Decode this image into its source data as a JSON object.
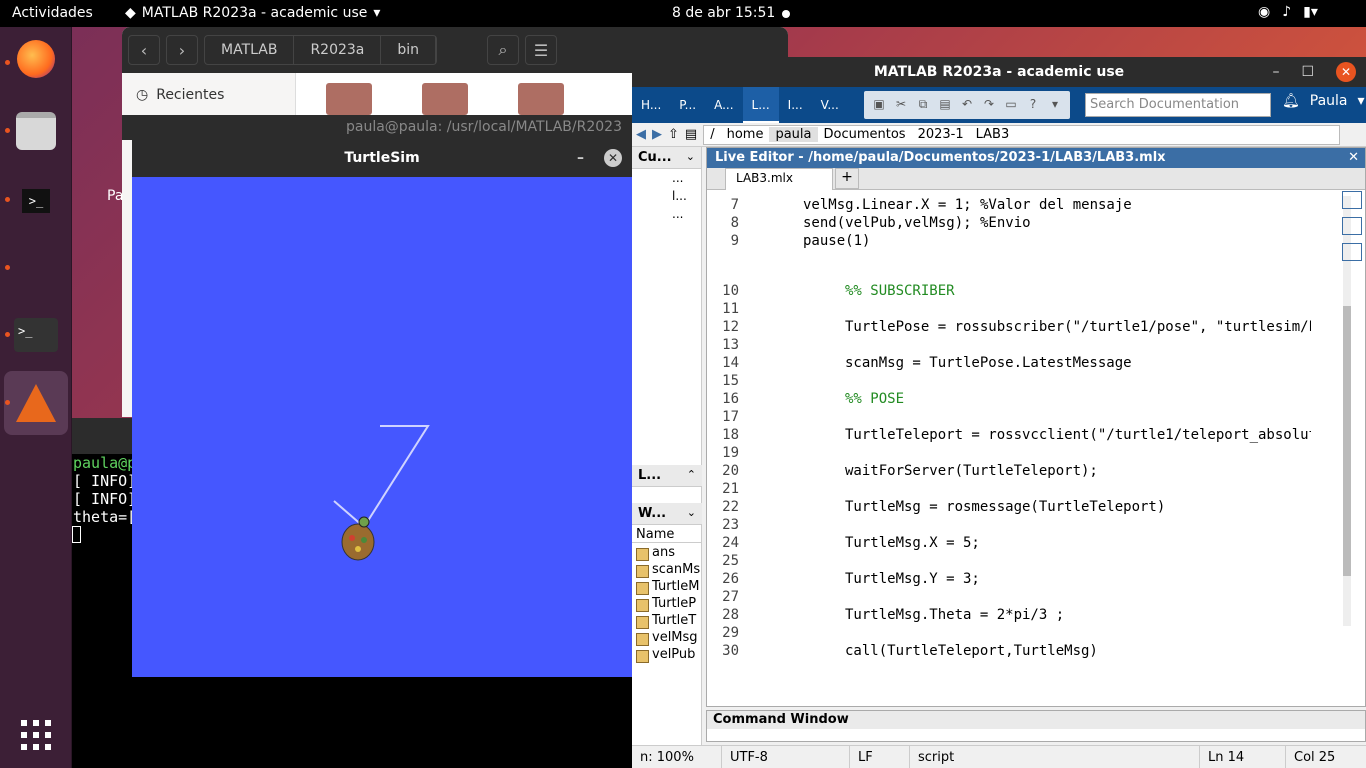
{
  "topbar": {
    "activities": "Actividades",
    "app_menu": "MATLAB R2023a - academic use",
    "clock": "8 de abr  15:51"
  },
  "files": {
    "path": [
      "MATLAB",
      "R2023a",
      "bin"
    ],
    "sidebar_recent": "Recientes",
    "desktop_label": "Pa"
  },
  "terminal_back": {
    "title": "paula@paula: /usr/local/MATLAB/R2023",
    "lines": [
      "paula@p",
      "[ INFO]",
      "[ INFO]",
      "theta=["
    ]
  },
  "turtlesim": {
    "title": "TurtleSim",
    "bg_color": "#4557ff"
  },
  "matlab": {
    "title": "MATLAB R2023a - academic use",
    "tabs": [
      "H...",
      "P...",
      "A...",
      "L...",
      "I...",
      "V..."
    ],
    "search_placeholder": "Search Documentation",
    "user": "Paula",
    "address": [
      "/",
      "home",
      "paula",
      "Documentos",
      "2023-1",
      "LAB3"
    ],
    "current_folder_header": "Cu...",
    "current_folder_items": [
      "...",
      "l...",
      "..."
    ],
    "live_header": "L...",
    "workspace_header": "W...",
    "workspace_col": "Name",
    "workspace_items": [
      "ans",
      "scanMs",
      "TurtleM",
      "TurtleP",
      "TurtleT",
      "velMsg",
      "velPub"
    ],
    "editor_title": "Live Editor - /home/paula/Documentos/2023-1/LAB3/LAB3.mlx",
    "editor_tab": "LAB3.mlx",
    "code": [
      {
        "n": "7",
        "t": "velMsg.Linear.X = 1; %Valor del mensaje"
      },
      {
        "n": "8",
        "t": "send(velPub,velMsg); %Envio"
      },
      {
        "n": "9",
        "t": "pause(1)"
      },
      {
        "n": "10",
        "t": "%% SUBSCRIBER"
      },
      {
        "n": "11",
        "t": ""
      },
      {
        "n": "12",
        "t": "TurtlePose = rossubscriber(\"/turtle1/pose\", \"turtlesim/P"
      },
      {
        "n": "13",
        "t": ""
      },
      {
        "n": "14",
        "t": "scanMsg = TurtlePose.LatestMessage"
      },
      {
        "n": "15",
        "t": ""
      },
      {
        "n": "16",
        "t": "%% POSE"
      },
      {
        "n": "17",
        "t": ""
      },
      {
        "n": "18",
        "t": "TurtleTeleport = rossvcclient(\"/turtle1/teleport_absolut"
      },
      {
        "n": "19",
        "t": ""
      },
      {
        "n": "20",
        "t": "waitForServer(TurtleTeleport);"
      },
      {
        "n": "21",
        "t": ""
      },
      {
        "n": "22",
        "t": "TurtleMsg = rosmessage(TurtleTeleport)"
      },
      {
        "n": "23",
        "t": ""
      },
      {
        "n": "24",
        "t": "TurtleMsg.X = 5;"
      },
      {
        "n": "25",
        "t": ""
      },
      {
        "n": "26",
        "t": "TurtleMsg.Y = 3;"
      },
      {
        "n": "27",
        "t": ""
      },
      {
        "n": "28",
        "t": "TurtleMsg.Theta = 2*pi/3 ;"
      },
      {
        "n": "29",
        "t": ""
      },
      {
        "n": "30",
        "t": "call(TurtleTeleport,TurtleMsg)"
      }
    ],
    "command_window": "Command Window",
    "status": {
      "zoom": "n: 100%",
      "encoding": "UTF-8",
      "eol": "LF",
      "type": "script",
      "ln": "Ln  14",
      "col": "Col  25"
    }
  }
}
